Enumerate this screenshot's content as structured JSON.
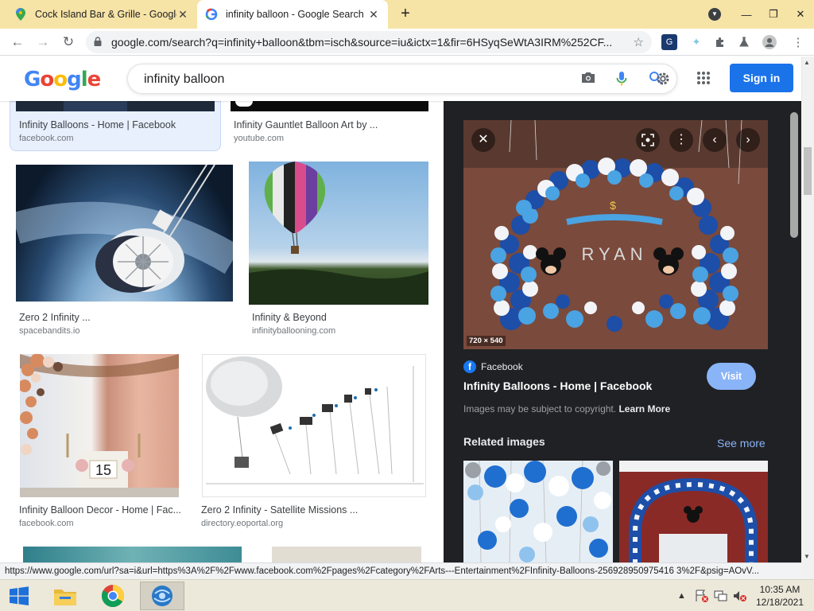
{
  "colors": {
    "google_blue": "#1a73e8",
    "panel_bg": "#202124",
    "link_blue": "#8ab4f8",
    "tab_strip": "#f6e3a6"
  },
  "tabs": [
    {
      "title": "Cock Island Bar & Grille - Google",
      "icon": "maps-pin-icon"
    },
    {
      "title": "infinity balloon - Google Search",
      "icon": "google-g-icon"
    }
  ],
  "toolbar": {
    "url": "google.com/search?q=infinity+balloon&tbm=isch&source=iu&ictx=1&fir=6HSyqSeWtA3IRM%252CF..."
  },
  "search": {
    "query": "infinity balloon",
    "signin_label": "Sign in",
    "logo": "Google"
  },
  "results": [
    {
      "title": "Infinity Balloons - Home | Facebook",
      "source": "facebook.com"
    },
    {
      "title": "Infinity Gauntlet Balloon Art by ...",
      "source": "youtube.com"
    },
    {
      "title": "Zero 2 Infinity ...",
      "source": "spacebandits.io"
    },
    {
      "title": "Infinity & Beyond",
      "source": "infinityballooning.com"
    },
    {
      "title": "Infinity Balloon Decor - Home | Fac...",
      "source": "facebook.com"
    },
    {
      "title": "Zero 2 Infinity - Satellite Missions ...",
      "source": "directory.eoportal.org"
    }
  ],
  "preview": {
    "dimensions": "720 × 540",
    "source": "Facebook",
    "title": "Infinity Balloons - Home | Facebook",
    "visit_label": "Visit",
    "copyright_text": "Images may be subject to copyright.",
    "learn_more": "Learn More",
    "related_label": "Related images",
    "see_more_label": "See more",
    "image_banner_text": "RYAN"
  },
  "status_url": "https://www.google.com/url?sa=i&url=https%3A%2F%2Fwww.facebook.com%2Fpages%2Fcategory%2FArts---Entertainment%2FInfinity-Balloons-256928950975416 3%2F&psig=AOvV...",
  "clock": {
    "time": "10:35 AM",
    "date": "12/18/2021"
  }
}
